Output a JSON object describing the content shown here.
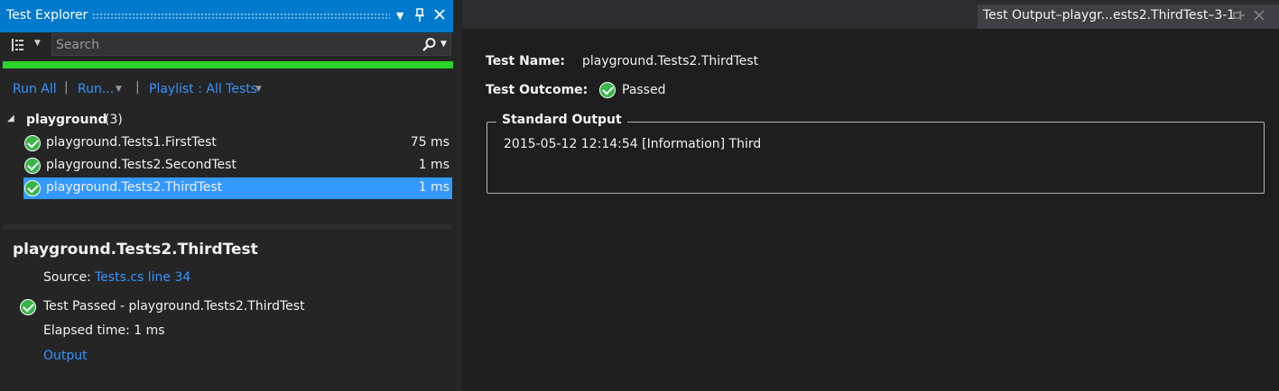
{
  "test_explorer": {
    "title": "Test Explorer",
    "search_placeholder": "Search",
    "run_all": "Run All",
    "run": "Run...",
    "playlist": "Playlist : All Tests",
    "group": {
      "name": "playground",
      "count": "(3)"
    },
    "tests": [
      {
        "name": "playground.Tests1.FirstTest",
        "duration": "75 ms",
        "selected": false
      },
      {
        "name": "playground.Tests2.SecondTest",
        "duration": "1 ms",
        "selected": false
      },
      {
        "name": "playground.Tests2.ThirdTest",
        "duration": "1 ms",
        "selected": true
      }
    ],
    "progress_fraction": 1.0,
    "colors": {
      "accent": "#007acc",
      "progress": "#2bd42b",
      "selection": "#3399ff",
      "link": "#3794ff"
    }
  },
  "details": {
    "title": "playground.Tests2.ThirdTest",
    "source_label": "Source:",
    "source_link": "Tests.cs line 34",
    "result": "Test Passed - playground.Tests2.ThirdTest",
    "elapsed": "Elapsed time: 1 ms",
    "output_link": "Output"
  },
  "output_tab": {
    "title": "Test Output–playgr...ests2.ThirdTest–3-1",
    "test_name_label": "Test Name:",
    "test_name_value": "playground.Tests2.ThirdTest",
    "outcome_label": "Test Outcome:",
    "outcome_value": "Passed",
    "std_output_label": "Standard Output",
    "std_output_text": "2015-05-12 12:14:54 [Information] Third"
  }
}
